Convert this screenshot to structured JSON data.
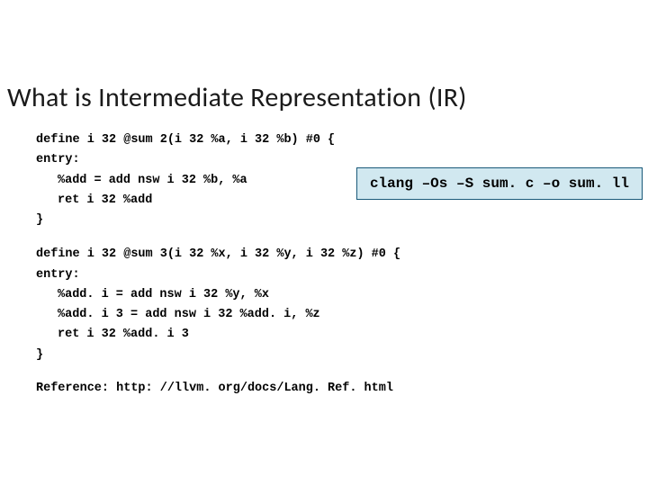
{
  "title": "What is Intermediate Representation (IR)",
  "code_block1": {
    "line1": "define i 32 @sum 2(i 32 %a, i 32 %b) #0 {",
    "line2": "entry:",
    "line3": "%add = add nsw i 32 %b, %a",
    "line4": "ret i 32 %add",
    "line5": "}"
  },
  "command": "clang –Os –S sum. c –o sum. ll",
  "code_block2": {
    "line1": "define i 32 @sum 3(i 32 %x, i 32 %y, i 32 %z) #0 {",
    "line2": "entry:",
    "line3": "%add. i = add nsw i 32 %y, %x",
    "line4": "%add. i 3 = add nsw i 32 %add. i, %z",
    "line5": "ret i 32 %add. i 3",
    "line6": "}"
  },
  "reference": "Reference: http: //llvm. org/docs/Lang. Ref. html"
}
